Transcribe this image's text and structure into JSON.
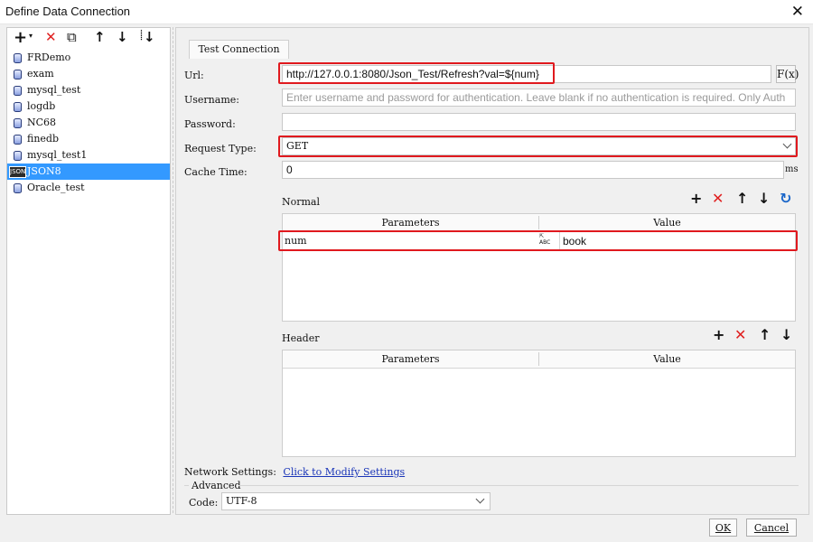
{
  "window": {
    "title": "Define Data Connection",
    "close_label": "✕"
  },
  "left_toolbar": {
    "add": "+",
    "add_arrow": "▾",
    "delete": "✕",
    "copy": "⧉",
    "up": "↑",
    "down": "↓",
    "sort": "↓"
  },
  "connections": [
    {
      "label": "FRDemo",
      "icon": "database-icon"
    },
    {
      "label": "exam",
      "icon": "database-icon"
    },
    {
      "label": "mysql_test",
      "icon": "database-icon"
    },
    {
      "label": "logdb",
      "icon": "database-icon"
    },
    {
      "label": "NC68",
      "icon": "database-icon"
    },
    {
      "label": "finedb",
      "icon": "database-icon"
    },
    {
      "label": "mysql_test1",
      "icon": "database-icon"
    },
    {
      "label": "JSON8",
      "icon": "json-icon",
      "selected": true,
      "icon_text": "JSON"
    },
    {
      "label": "Oracle_test",
      "icon": "database-icon"
    }
  ],
  "form": {
    "test_connection": "Test Connection",
    "url_label": "Url:",
    "url_value": "http://127.0.0.1:8080/Json_Test/Refresh?val=${num}",
    "fx_label": "F(x)",
    "username_label": "Username:",
    "username_placeholder": "Enter username and password for authentication. Leave blank if no authentication is required. Only Auth",
    "password_label": "Password:",
    "password_value": "",
    "request_type_label": "Request Type:",
    "request_type_value": "GET",
    "cache_time_label": "Cache Time:",
    "cache_time_value": "0",
    "cache_time_unit": "ms"
  },
  "normal": {
    "title": "Normal",
    "columns": [
      "Parameters",
      "Value"
    ],
    "rows": [
      {
        "param": "num",
        "type_icon": "ABC",
        "value": "book"
      }
    ]
  },
  "header": {
    "title": "Header",
    "columns": [
      "Parameters",
      "Value"
    ]
  },
  "network": {
    "label": "Network Settings:",
    "link": "Click to Modify Settings"
  },
  "advanced": {
    "title": "Advanced",
    "code_label": "Code:",
    "code_value": "UTF-8"
  },
  "buttons": {
    "ok": "OK",
    "cancel": "Cancel"
  },
  "icons": {
    "add": "+",
    "delete": "✕",
    "up": "↑",
    "down": "↓",
    "refresh": "↻"
  },
  "colors": {
    "selection": "#3399ff",
    "highlight": "#e0191e",
    "link": "#1a35b8"
  }
}
